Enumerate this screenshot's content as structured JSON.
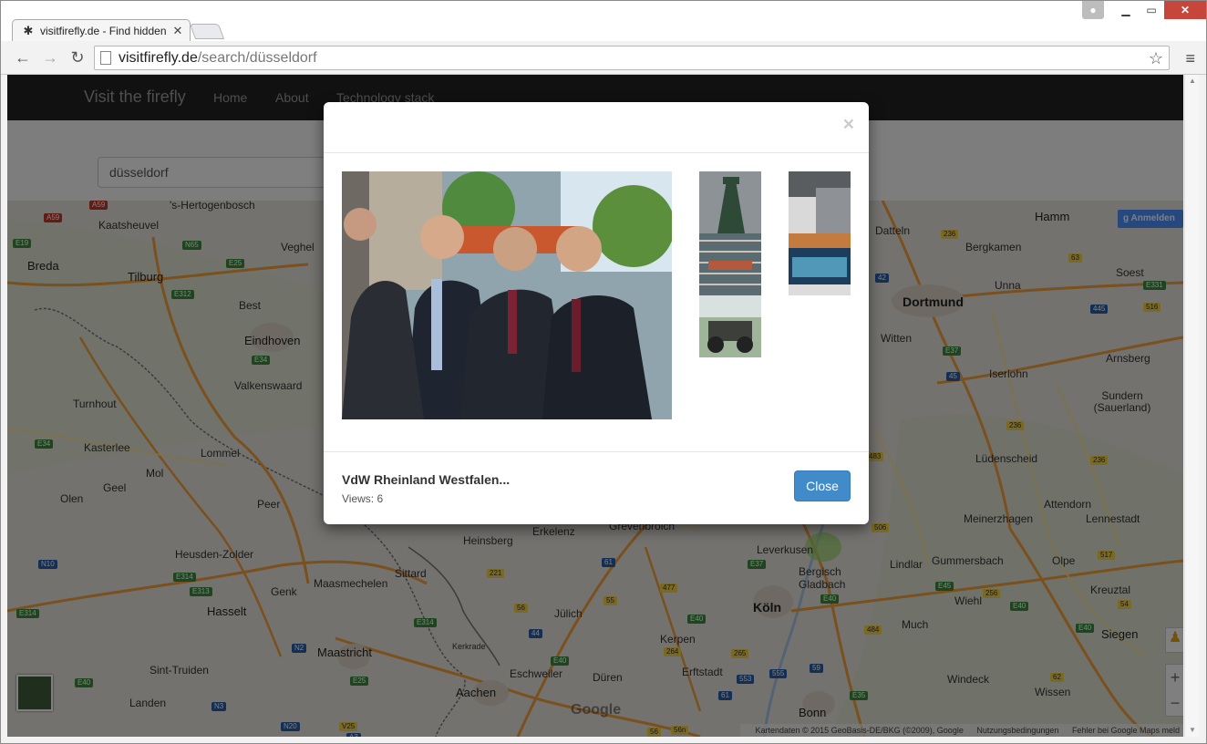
{
  "browser": {
    "tab_title": "visitfirefly.de - Find hidden",
    "url_host": "visitfirefly.de",
    "url_path": "/search/düsseldorf",
    "icons": [
      "back-arrow-icon",
      "forward-arrow-icon",
      "reload-icon",
      "star-icon",
      "menu-icon"
    ]
  },
  "navbar": {
    "brand": "Visit the firefly",
    "links": [
      "Home",
      "About",
      "Technology stack"
    ]
  },
  "search": {
    "value": "düsseldorf"
  },
  "map": {
    "anmelden": "Anmelden",
    "google": "Google",
    "attribution": [
      "Kartendaten © 2015 GeoBasis-DE/BKG (©2009), Google",
      "Nutzungsbedingungen",
      "Fehler bei Google Maps meld"
    ],
    "cities_big": [
      "Dortmund",
      "Köln"
    ],
    "cities": [
      "Breda",
      "Tilburg",
      "Eindhoven",
      "Best",
      "Veghel",
      "Turnhout",
      "Valkenswaard",
      "Kaatsheuvel",
      "Hamm",
      "Bergkamen",
      "Soest",
      "Unna",
      "Witten",
      "Iserlohn",
      "Arnsberg",
      "Sundern (Sauerland)",
      "Lüdenscheid",
      "Attendorn",
      "Meinerzhagen",
      "Lennestadt",
      "Gummersbach",
      "Olpe",
      "Bergisch Gladbach",
      "Leverkusen",
      "Wiehl",
      "Kreuztal",
      "Siegen",
      "Much",
      "Windeck",
      "Wissen",
      "Bonn",
      "Erftstadt",
      "Kerpen",
      "Düren",
      "Eschweiler",
      "Aachen",
      "Jülich",
      "Maastricht",
      "Sittard",
      "Heinsberg",
      "Erkelenz",
      "Grevenbroich",
      "Hasselt",
      "Genk",
      "Maasmechelen",
      "Heusden-Zolder",
      "Geel",
      "Mol",
      "Olen",
      "Kasterlee",
      "Lommel",
      "Peer",
      "Sint-Truiden",
      "Landen",
      "Datteln",
      "Lindlar",
      "Kerkrade",
      "'s-Hertogenbosch"
    ]
  },
  "modal": {
    "close_x": "×",
    "title": "VdW Rheinland Westfalen...",
    "views": "Views: 6",
    "close_button": "Close"
  }
}
